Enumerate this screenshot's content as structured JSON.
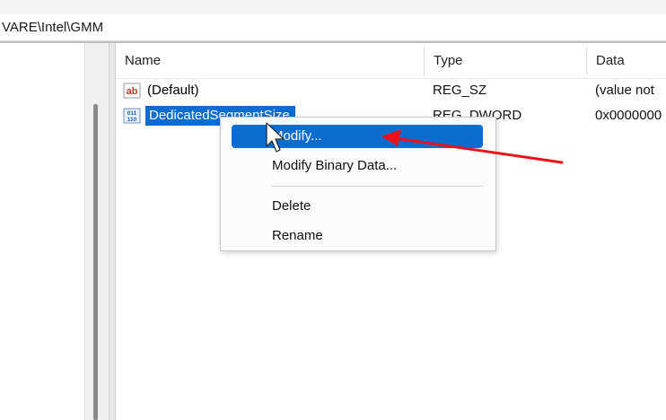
{
  "address_path": "VARE\\Intel\\GMM",
  "columns": {
    "name": "Name",
    "type": "Type",
    "data": "Data"
  },
  "rows": [
    {
      "name": "(Default)",
      "type": "REG_SZ",
      "data": "(value not",
      "icon": "string-value-icon"
    },
    {
      "name": "DedicatedSegmentSize",
      "type": "REG_DWORD",
      "data": "0x0000000",
      "icon": "binary-value-icon",
      "selected": true
    }
  ],
  "context_menu": {
    "items": [
      {
        "label": "Modify...",
        "highlighted": true
      },
      {
        "label": "Modify Binary Data..."
      },
      {
        "label": "Delete"
      },
      {
        "label": "Rename"
      }
    ]
  },
  "icon_glyphs": {
    "string": "ab",
    "binary": "011|110"
  },
  "colors": {
    "selection": "#0a6dcd",
    "arrow": "#e8131a",
    "string_icon": "#c0392b",
    "binary_icon": "#1e5fb0"
  }
}
